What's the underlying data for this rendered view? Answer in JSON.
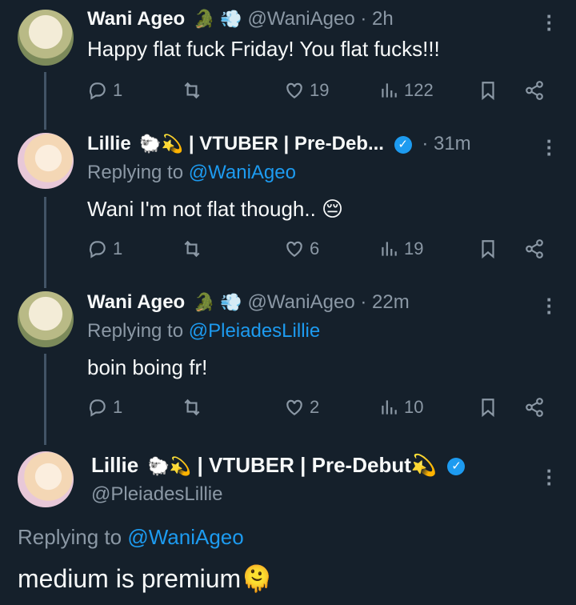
{
  "tweets": [
    {
      "name": "Wani Ageo",
      "emojis": "🐊 💨",
      "handle": "@WaniAgeo",
      "time": "· 2h",
      "replying_prefix": "",
      "replying_handle": "",
      "text": "Happy flat fuck Friday! You flat fucks!!!",
      "replies": "1",
      "likes": "19",
      "views": "122"
    },
    {
      "name": "Lillie",
      "emojis": "🐑💫",
      "name_suffix": "| VTUBER | Pre-Deb...",
      "time": "· 31m",
      "replying_prefix": "Replying to ",
      "replying_handle": "@WaniAgeo",
      "text": "Wani I'm not flat though.. 😔",
      "replies": "1",
      "likes": "6",
      "views": "19"
    },
    {
      "name": "Wani Ageo",
      "emojis": "🐊 💨",
      "handle": "@WaniAgeo",
      "time": "· 22m",
      "replying_prefix": "Replying to ",
      "replying_handle": "@PleiadesLillie",
      "text": "boin boing fr!",
      "replies": "1",
      "likes": "2",
      "views": "10"
    }
  ],
  "main": {
    "name": "Lillie",
    "emojis": "🐑💫",
    "name_suffix": "| VTUBER | Pre-Debut💫",
    "handle": "@PleiadesLillie",
    "replying_prefix": "Replying to ",
    "replying_handle": "@WaniAgeo",
    "text": "medium is premium🫠"
  },
  "colors": {
    "background": "#15202b",
    "muted": "#8b98a5",
    "link": "#1d9bf0",
    "text": "#f7f9f9"
  }
}
